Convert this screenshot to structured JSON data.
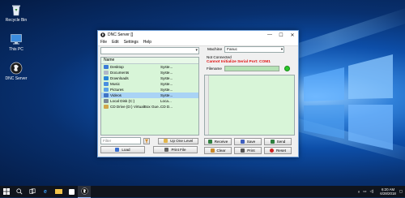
{
  "desktop": {
    "icons": [
      {
        "label": "Recycle Bin",
        "icon": "recycle-bin-icon"
      },
      {
        "label": "This PC",
        "icon": "monitor-icon"
      },
      {
        "label": "DNC Server",
        "icon": "dnc-server-icon"
      }
    ]
  },
  "window": {
    "title": "DNC Server []",
    "minimize": "—",
    "maximize": "☐",
    "close": "✕",
    "menu": [
      "File",
      "Edit",
      "Settings",
      "Help"
    ]
  },
  "left": {
    "path_value": "",
    "column_name": "Name",
    "files": [
      {
        "name": "Desktop",
        "type": "Syste...",
        "color": "#3b7bd8"
      },
      {
        "name": "Documents",
        "type": "Syste...",
        "color": "#b0b8c8"
      },
      {
        "name": "Downloads",
        "type": "Syste...",
        "color": "#2a86d6"
      },
      {
        "name": "Music",
        "type": "Syste...",
        "color": "#4a8ee0"
      },
      {
        "name": "Pictures",
        "type": "Syste...",
        "color": "#5aa0e8"
      },
      {
        "name": "Videos",
        "type": "Syste...",
        "color": "#3f74c4"
      },
      {
        "name": "Local Disk (C:)",
        "type": "Loca...",
        "color": "#7c8896"
      },
      {
        "name": "CD Drive (D:) VirtualBox Gue...",
        "type": "CD D...",
        "color": "#d0a64a"
      }
    ],
    "selected_index": 5,
    "filter_placeholder": "Filter",
    "up_one_level": "Up One Level",
    "load": "Load",
    "print_file": "Print File"
  },
  "right": {
    "machine_label": "Machine",
    "machine_value": "Fanuc",
    "status_connection": "Not Connected",
    "status_error": "Cannot Initialize Serial Port: COM1",
    "filename_label": "Filename",
    "filename_value": "",
    "buttons": [
      {
        "label": "Receive",
        "icon": "receive-icon",
        "color": "#2f7f3f"
      },
      {
        "label": "Save",
        "icon": "save-icon",
        "color": "#3f5fbf"
      },
      {
        "label": "Send",
        "icon": "send-icon",
        "color": "#2f7f3f"
      },
      {
        "label": "Clear",
        "icon": "clear-icon",
        "color": "#c98b2c"
      },
      {
        "label": "Print",
        "icon": "print-icon",
        "color": "#555555"
      },
      {
        "label": "Reset",
        "icon": "reset-icon",
        "color": "#d02020"
      }
    ]
  },
  "taskbar": {
    "clock_time": "6:20 AM",
    "clock_date": "6/28/2018"
  },
  "colors": {
    "accent": "#6f9fd8",
    "list_bg": "#d8f5d8",
    "error": "#e01010"
  }
}
